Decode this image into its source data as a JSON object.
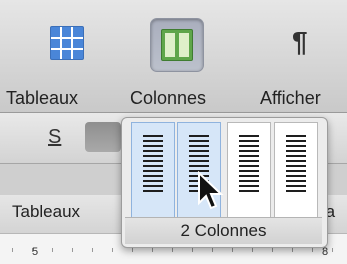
{
  "toolbar": {
    "items": [
      {
        "label": "Tableaux",
        "icon": "table-grid-icon",
        "selected": false
      },
      {
        "label": "Colonnes",
        "icon": "columns-icon",
        "selected": true
      },
      {
        "label": "Afficher",
        "icon": "pilcrow-icon",
        "selected": false
      }
    ],
    "pilcrow_glyph": "¶"
  },
  "formatbar": {
    "underline_s_label": "S"
  },
  "sheetbar": {
    "tab_label": "Tableaux",
    "right_partial_label": "ra"
  },
  "ruler": {
    "marks": [
      "5",
      "8"
    ]
  },
  "columns_popover": {
    "options": [
      {
        "columns": 1,
        "selected": true
      },
      {
        "columns": 2,
        "selected": true
      },
      {
        "columns": 3,
        "selected": false
      },
      {
        "columns": 4,
        "selected": false
      }
    ],
    "footer_label": "2 Colonnes"
  },
  "colors": {
    "selection_fill": "#d6e6f8",
    "table_icon_blue": "#4a86d8",
    "columns_icon_green": "#5fa64a"
  }
}
